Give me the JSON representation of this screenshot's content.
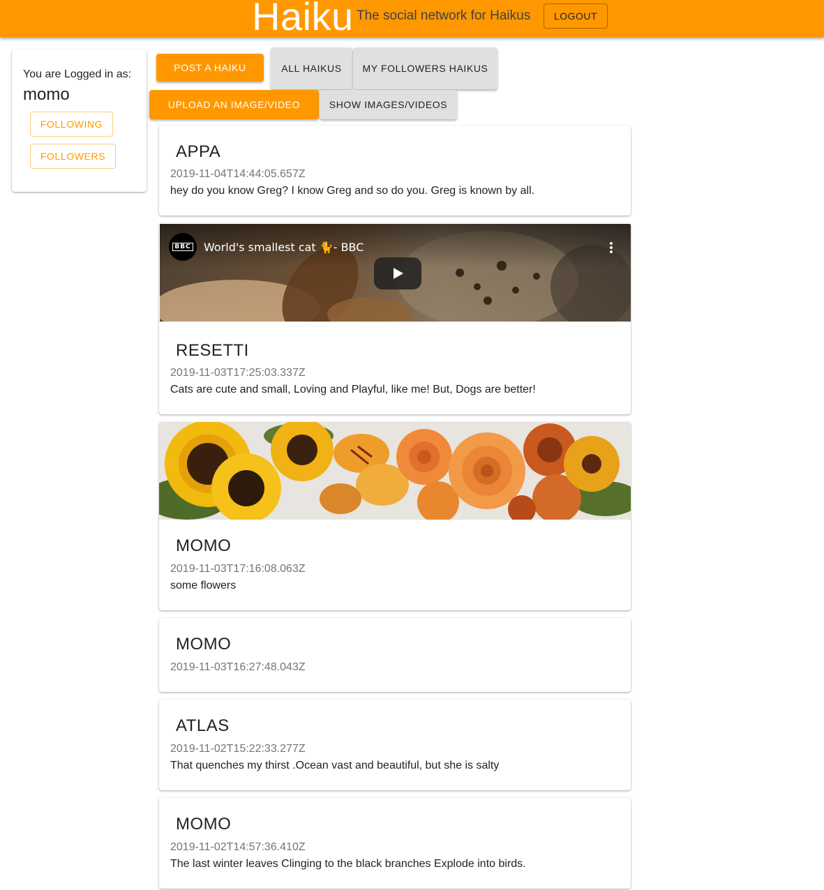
{
  "header": {
    "brand": "Haiku",
    "tagline": "The social network for Haikus",
    "logout_label": "LOGOUT"
  },
  "user_panel": {
    "logged_label": "You are Logged in as:",
    "username": "momo",
    "following_label": "FOLLOWING",
    "followers_label": "FOLLOWERS"
  },
  "actions": {
    "post_label": "POST A HAIKU",
    "all_label": "ALL HAIKUS",
    "followers_haikus_label": "MY FOLLOWERS HAIKUS",
    "upload_label": "UPLOAD AN IMAGE/VIDEO",
    "show_media_label": "SHOW IMAGES/VIDEOS"
  },
  "video": {
    "channel_badge": "BBC",
    "title": "World's smallest cat 🐈- BBC"
  },
  "posts": [
    {
      "author": "APPA",
      "timestamp": "2019-11-04T14:44:05.657Z",
      "text": "hey do you know Greg? I know Greg and so do you. Greg is known by all."
    },
    {
      "author": "RESETTI",
      "timestamp": "2019-11-03T17:25:03.337Z",
      "text": "Cats are cute and small, Loving and Playful, like me! But, Dogs are better!"
    },
    {
      "author": "MOMO",
      "timestamp": "2019-11-03T17:16:08.063Z",
      "text": "some flowers"
    },
    {
      "author": "MOMO",
      "timestamp": "2019-11-03T16:27:48.043Z",
      "text": ""
    },
    {
      "author": "ATLAS",
      "timestamp": "2019-11-02T15:22:33.277Z",
      "text": "That quenches my thirst .Ocean vast and beautiful, but she is salty"
    },
    {
      "author": "MOMO",
      "timestamp": "2019-11-02T14:57:36.410Z",
      "text": "The last winter leaves Clinging to the black branches Explode into birds."
    }
  ],
  "colors": {
    "accent": "#ff9800",
    "accent_outline": "#ffcc80",
    "button_grey": "#e0e0e0",
    "timestamp_grey": "#757575"
  }
}
